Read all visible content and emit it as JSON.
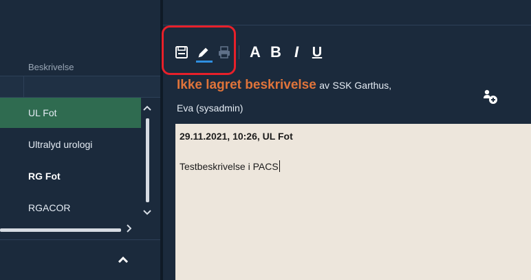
{
  "left_panel": {
    "column_header": "Beskrivelse",
    "items": [
      {
        "label": "UL Fot",
        "selected": true,
        "bold": false
      },
      {
        "label": "Ultralyd urologi",
        "selected": false,
        "bold": false
      },
      {
        "label": "RG Fot",
        "selected": false,
        "bold": true
      },
      {
        "label": "RGACOR",
        "selected": false,
        "bold": false
      }
    ],
    "scroll_up_icon": "chevron-up-icon",
    "scroll_down_icon": "chevron-down-icon",
    "scroll_right_icon": "chevron-right-icon",
    "collapse_icon": "caret-up-icon"
  },
  "toolbar": {
    "save_icon": "save-icon",
    "edit_icon": "pencil-icon",
    "edit_active": true,
    "print_icon": "printer-icon",
    "print_enabled": false,
    "font_size_label": "A",
    "bold_label": "B",
    "italic_label": "I",
    "underline_label": "U"
  },
  "document": {
    "status_title": "Ikke lagret beskrivelse",
    "by_label": "av",
    "author_line1": "SSK Garthus,",
    "author_line2": "Eva (sysadmin)",
    "add_user_icon": "add-user-icon",
    "heading": "29.11.2021, 10:26, UL Fot",
    "body": "Testbeskrivelse i PACS"
  },
  "colors": {
    "panel_bg": "#1b2a3c",
    "selected_row": "#2f6b50",
    "status_orange": "#e0743a",
    "editor_bg": "#ede6dc",
    "highlight_red": "#e8202a",
    "active_blue": "#2f8fe0"
  }
}
